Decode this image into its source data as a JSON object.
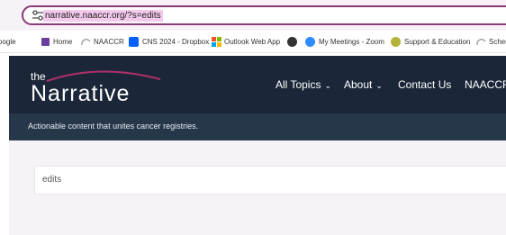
{
  "browser": {
    "url": "narrative.naaccr.org/?s=edits"
  },
  "bookmarks": [
    {
      "label": "oogle",
      "icon": "google-icon",
      "color": "#4285f4"
    },
    {
      "label": "Home",
      "icon": "home-bookmark-icon",
      "color": "#6b3fa0"
    },
    {
      "label": "NAACCR",
      "icon": "naaccr-logo-icon",
      "color": "#777777"
    },
    {
      "label": "CNS 2024 - Dropbox",
      "icon": "dropbox-icon",
      "color": "#0061fe"
    },
    {
      "label": "Outlook Web App",
      "icon": "microsoft-icon",
      "color": "#f25022"
    },
    {
      "label": "",
      "icon": "globe-icon",
      "color": "#333333"
    },
    {
      "label": "My Meetings - Zoom",
      "icon": "zoom-icon",
      "color": "#2d8cff"
    },
    {
      "label": "Support & Education",
      "icon": "support-icon",
      "color": "#9c9c2a"
    },
    {
      "label": "Schem",
      "icon": "naaccr-logo-icon",
      "color": "#777777"
    }
  ],
  "site": {
    "logo_small": "the",
    "logo_main": "Narrative",
    "nav": {
      "all_topics": "All Topics",
      "about": "About",
      "contact": "Contact Us",
      "naaccr": "NAACCR"
    },
    "tagline": "Actionable content that unites cancer registries."
  },
  "search": {
    "value": "edits"
  },
  "colors": {
    "header_bg": "#1b2738",
    "tagline_bg": "#27374a",
    "content_bg": "#f5f3f6",
    "url_highlight": "#f3c9ec",
    "swoosh": "#b0306a"
  }
}
